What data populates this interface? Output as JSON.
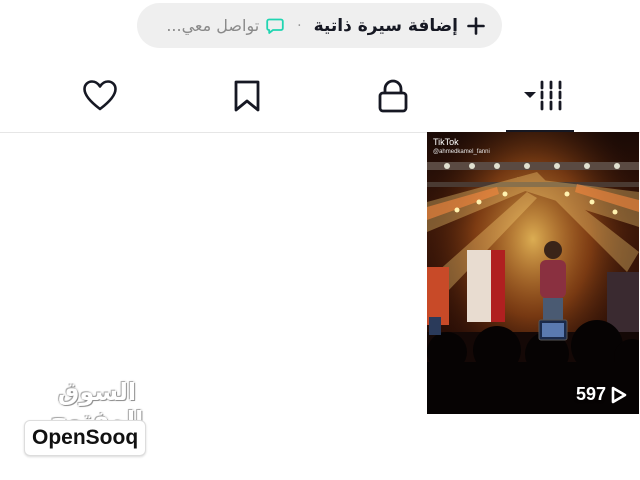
{
  "profile_actions": {
    "add_bio_label": "إضافة سيرة ذاتية",
    "separator": "·",
    "contact_placeholder": "تواصل معي...",
    "contact_icon": "chat-bubble-icon",
    "contact_icon_color": "#20d5b1",
    "add_icon": "plus-icon"
  },
  "tabs": [
    {
      "id": "videos",
      "icon": "grid-dropdown-icon",
      "active": true
    },
    {
      "id": "private",
      "icon": "lock-icon",
      "active": false
    },
    {
      "id": "saved",
      "icon": "bookmark-icon",
      "active": false
    },
    {
      "id": "liked",
      "icon": "heart-icon",
      "active": false
    }
  ],
  "videos": [
    {
      "overlay_app": "TikTok",
      "overlay_user": "@ahmedkamel_fanni",
      "view_count": "597",
      "play_icon": "play-icon"
    }
  ],
  "watermark": {
    "arabic": "السوق المفتوح",
    "latin": "OpenSooq"
  },
  "colors": {
    "text_primary": "#161823",
    "text_secondary": "#8a8a8a",
    "pill_background": "#efefef",
    "divider": "#e6e6e6",
    "accent": "#20d5b1"
  }
}
